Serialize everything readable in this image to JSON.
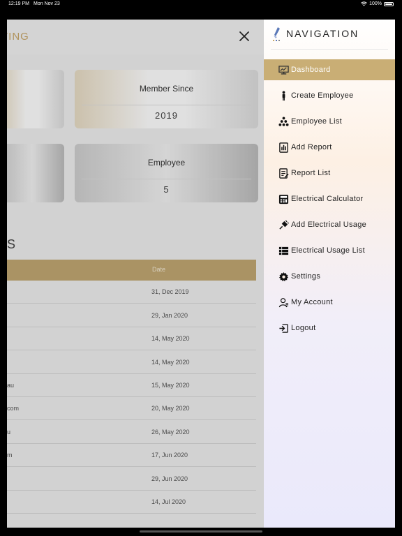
{
  "status_bar": {
    "time": "12:19 PM",
    "date": "Mon Nov 23",
    "battery": "100%"
  },
  "page": {
    "title": "TING",
    "cards": [
      {
        "label": "Member Since",
        "value": "2019"
      },
      {
        "label": "Employee",
        "value": "5"
      }
    ],
    "section_title": "S",
    "table": {
      "date_header": "Date",
      "rows": [
        {
          "c1": "",
          "date": "31, Dec 2019"
        },
        {
          "c1": "",
          "date": "29, Jan 2020"
        },
        {
          "c1": "",
          "date": "14, May 2020"
        },
        {
          "c1": "",
          "date": "14, May 2020"
        },
        {
          "c1": "au",
          "date": "15, May 2020"
        },
        {
          "c1": "com",
          "date": "20, May 2020"
        },
        {
          "c1": "u",
          "date": "26, May 2020"
        },
        {
          "c1": "m",
          "date": "17, Jun 2020"
        },
        {
          "c1": "",
          "date": "29, Jun 2020"
        },
        {
          "c1": "",
          "date": "14, Jul 2020"
        }
      ]
    }
  },
  "drawer": {
    "title": "NAVIGATION",
    "items": [
      {
        "label": "Dashboard",
        "icon": "dashboard-icon",
        "active": true
      },
      {
        "label": "Create Employee",
        "icon": "person-icon"
      },
      {
        "label": "Employee List",
        "icon": "hierarchy-icon"
      },
      {
        "label": "Add Report",
        "icon": "add-report-icon"
      },
      {
        "label": "Report List",
        "icon": "report-list-icon"
      },
      {
        "label": "Electrical Calculator",
        "icon": "calculator-icon"
      },
      {
        "label": "Add Electrical Usage",
        "icon": "plug-icon"
      },
      {
        "label": "Electrical Usage List",
        "icon": "list-icon"
      },
      {
        "label": "Settings",
        "icon": "gear-icon"
      },
      {
        "label": "My Account",
        "icon": "account-icon"
      },
      {
        "label": "Logout",
        "icon": "logout-icon"
      }
    ]
  },
  "colors": {
    "accent": "#c9ae75",
    "header_text": "#c9a86a"
  }
}
